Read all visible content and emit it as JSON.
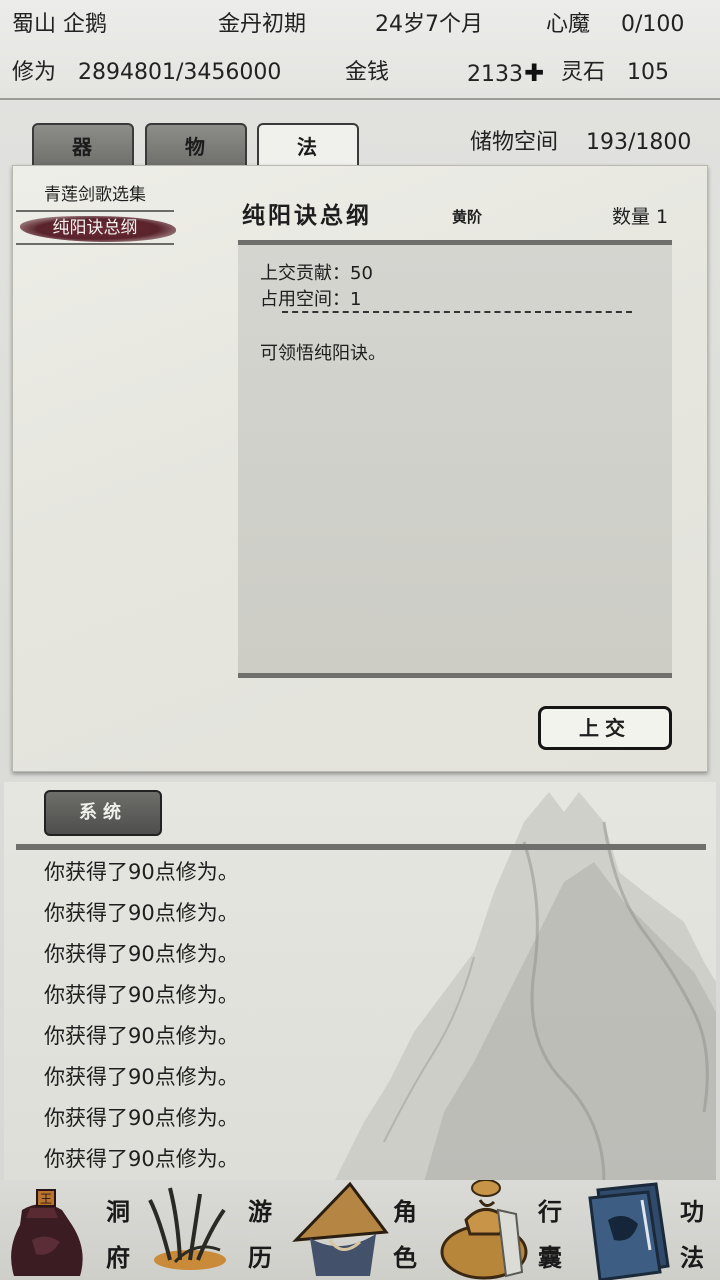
{
  "header": {
    "sect_name": "蜀山 企鹅",
    "realm": "金丹初期",
    "age": "24岁7个月",
    "heart_demon_label": "心魔",
    "heart_demon_value": "0/100",
    "cultivation_label": "修为",
    "cultivation_value": "2894801/3456000",
    "money_label": "金钱",
    "money_value": "2133",
    "spirit_stone_label": "灵石",
    "spirit_stone_value": "105"
  },
  "tabs": [
    {
      "label": "器",
      "active": false
    },
    {
      "label": "物",
      "active": false
    },
    {
      "label": "法",
      "active": true
    }
  ],
  "storage": {
    "label": "储物空间",
    "value": "193/1800"
  },
  "item_list": [
    {
      "label": "青莲剑歌选集",
      "selected": false
    },
    {
      "label": "纯阳诀总纲",
      "selected": true
    }
  ],
  "detail": {
    "title": "纯阳诀总纲",
    "grade": "黄阶",
    "quantity_label": "数量 1",
    "contribution": "上交贡献：50",
    "space": "占用空间：1",
    "description": "可领悟纯阳诀。",
    "submit_label": "上交"
  },
  "log": {
    "tab_label": "系统",
    "lines": [
      "你获得了90点修为。",
      "你获得了90点修为。",
      "你获得了90点修为。",
      "你获得了90点修为。",
      "你获得了90点修为。",
      "你获得了90点修为。",
      "你获得了90点修为。",
      "你获得了90点修为。"
    ]
  },
  "nav": [
    {
      "chars": [
        "洞",
        "府"
      ],
      "icon": "seal-pouch-icon"
    },
    {
      "chars": [
        "游",
        "历"
      ],
      "icon": "grass-icon"
    },
    {
      "chars": [
        "角",
        "色"
      ],
      "icon": "straw-hat-icon"
    },
    {
      "chars": [
        "行",
        "囊"
      ],
      "icon": "bundle-bag-icon"
    },
    {
      "chars": [
        "功",
        "法"
      ],
      "icon": "book-icon"
    }
  ]
}
